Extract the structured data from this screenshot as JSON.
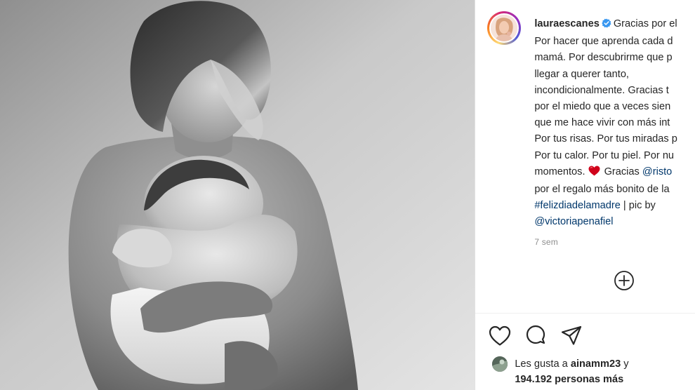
{
  "photo": {
    "description_icon": "black-and-white-photo"
  },
  "author": {
    "username": "lauraescanes",
    "verified_icon": "verified-badge-icon",
    "accent_color": "#3897f0"
  },
  "caption": {
    "line1_text": "Gracias por el",
    "line2": "Por hacer que aprenda cada d",
    "line3": "mamá. Por descubrirme que p",
    "line4": "llegar a querer tanto,",
    "line5": "incondicionalmente. Gracias t",
    "line6": "por el miedo que a veces sien",
    "line7": "que me hace vivir con más int",
    "line8": "Por tus risas. Por tus miradas p",
    "line9": "Por tu calor. Por tu piel. Por nu",
    "line10_text": "momentos.",
    "line10_emoji": "heart-emoji",
    "line10_gracias": "Gracias",
    "line10_mention": "@risto",
    "line11": "por el regalo más bonito de la",
    "line12_hashtag": "#felizdiadelamadre",
    "line12_rest": " | pic by",
    "line13_mention": "@victoriapenafiel"
  },
  "meta": {
    "time": "7 sem"
  },
  "actions": {
    "like_icon": "heart-icon",
    "comment_icon": "comment-icon",
    "share_icon": "paper-plane-icon",
    "add_comment_icon": "plus-circle-icon"
  },
  "likes": {
    "prefix": "Les gusta a ",
    "user": "ainamm23",
    "connector": " y",
    "count": "194.192 personas más"
  }
}
